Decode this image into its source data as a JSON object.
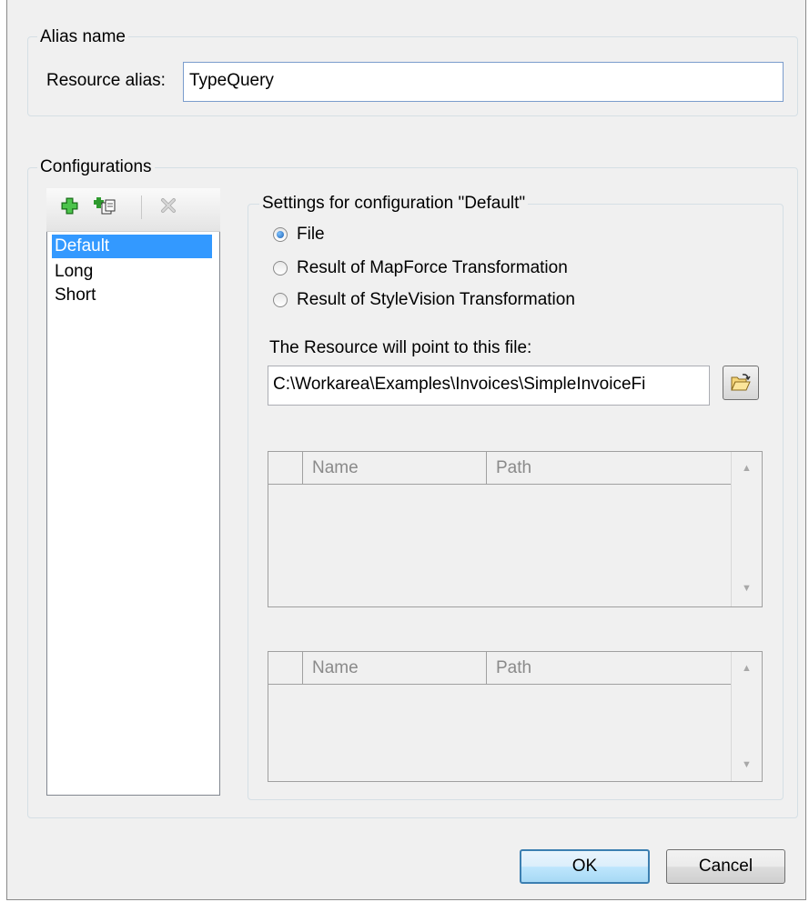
{
  "alias_group": {
    "legend": "Alias name",
    "label": "Resource alias:",
    "value": "TypeQuery"
  },
  "configurations_group": {
    "legend": "Configurations",
    "toolbar": {
      "add_icon": "add-icon",
      "copy_icon": "copy-icon",
      "delete_icon": "delete-icon"
    },
    "items": [
      "Default",
      "Long",
      "Short"
    ],
    "selected": "Default"
  },
  "settings": {
    "legend": "Settings for configuration \"Default\"",
    "options": [
      "File",
      "Result of MapForce Transformation",
      "Result of StyleVision Transformation"
    ],
    "selected_option": "File",
    "file_label": "The Resource will point to this file:",
    "file_path": "C:\\Workarea\\Examples\\Invoices\\SimpleInvoiceFi",
    "browse_icon": "folder-open-icon",
    "grids": [
      {
        "columns": [
          "Name",
          "Path"
        ]
      },
      {
        "columns": [
          "Name",
          "Path"
        ]
      }
    ]
  },
  "buttons": {
    "ok": "OK",
    "cancel": "Cancel"
  },
  "colors": {
    "selection": "#3399ff",
    "dialog_bg": "#f0f0f0",
    "default_button_border": "#3c7fb1"
  }
}
